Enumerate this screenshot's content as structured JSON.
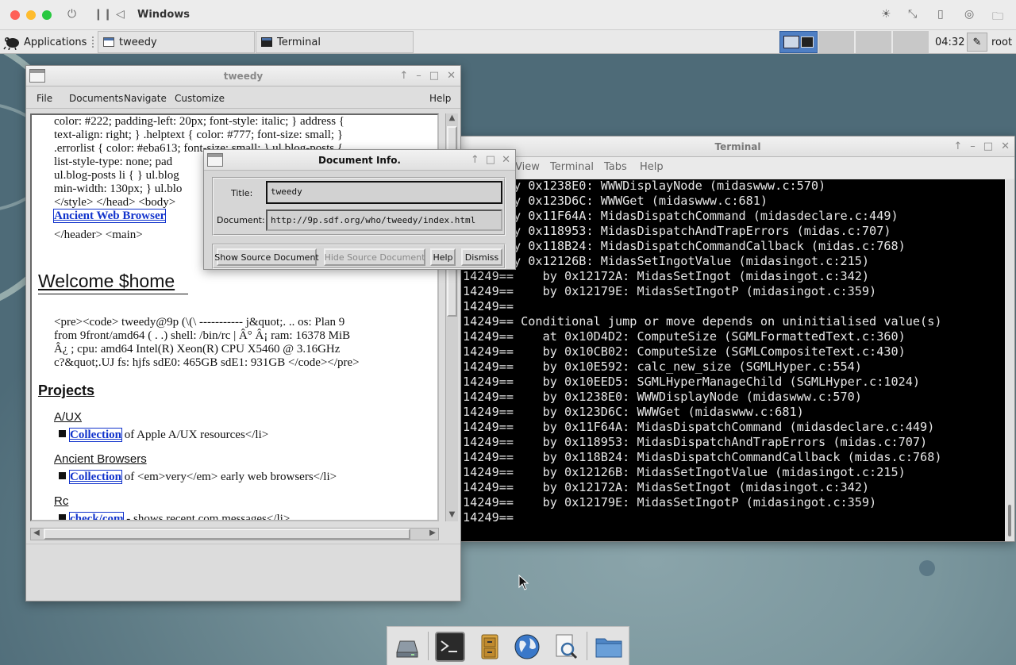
{
  "host": {
    "title": "Windows",
    "colors": {
      "close": "#fe5f57",
      "minimize": "#febc2e",
      "zoom": "#28c840"
    },
    "icons": [
      "power-icon",
      "pause-icon",
      "back-icon",
      "brightness-icon",
      "resize-icon",
      "usb-icon",
      "display-icon",
      "folder-icon"
    ]
  },
  "panel": {
    "applications": "Applications",
    "tasks": [
      {
        "label": "tweedy"
      },
      {
        "label": "Terminal"
      }
    ],
    "clock": "04:32",
    "user": "root"
  },
  "tweedy": {
    "title": "tweedy",
    "menu": [
      "File",
      "Documents",
      "Navigate",
      "Customize",
      "Help"
    ],
    "css_lines": [
      "color: #222; padding-left: 20px; font-style: italic; } address {",
      "text-align: right; } .helptext { color: #777; font-size: small; }",
      ".errorlist { color: #eba613; font-size: small; } ul.blog-posts {",
      "list-style-type: none; pad",
      "ul.blog-posts li { } ul.blog",
      "min-width: 130px; } ul.blo",
      "</style> </head> <body>"
    ],
    "link_ancient": "Ancient Web Browser",
    "header_close": "</header> <main>",
    "heading": "Welcome $home",
    "pre_lines": [
      "<pre><code> tweedy@9p (\\(\\ ----------- j&quot;. .. os: Plan 9",
      "from 9front/amd64 ( . .) shell: /bin/rc | Â° Â¡ ram: 16378 MiB",
      "Â¿ ; cpu: amd64 Intel(R) Xeon(R) CPU X5460 @ 3.16GHz",
      "c?&quot;.UJ fs: hjfs sdE0: 465GB sdE1: 931GB </code></pre>"
    ],
    "projects_heading": "Projects",
    "projects": [
      {
        "name": "A/UX",
        "link": "Collection",
        "desc": " of Apple A/UX resources</li>"
      },
      {
        "name": "Ancient Browsers",
        "link": "Collection",
        "desc": " of <em>very</em> early web browsers</li>"
      },
      {
        "name": "Rc",
        "link": "check/com",
        "desc": " - shows recent com messages</li>"
      }
    ]
  },
  "docinfo": {
    "title": "Document Info.",
    "title_label": "Title:",
    "title_value": "tweedy",
    "document_label": "Document:",
    "document_value": "http://9p.sdf.org/who/tweedy/index.html",
    "buttons": {
      "show_source": "Show Source Document",
      "hide_source": "Hide Source Document",
      "help": "Help",
      "dismiss": "Dismiss"
    }
  },
  "terminal": {
    "title": "Terminal",
    "menu": [
      "View",
      "Terminal",
      "Tabs",
      "Help"
    ],
    "lines": [
      "==    by 0x1238E0: WWWDisplayNode (midaswww.c:570)",
      "==    by 0x123D6C: WWWGet (midaswww.c:681)",
      "==    by 0x11F64A: MidasDispatchCommand (midasdeclare.c:449)",
      "==    by 0x118953: MidasDispatchAndTrapErrors (midas.c:707)",
      "==    by 0x118B24: MidasDispatchCommandCallback (midas.c:768)",
      "==    by 0x12126B: MidasSetIngotValue (midasingot.c:215)",
      "14249==    by 0x12172A: MidasSetIngot (midasingot.c:342)",
      "14249==    by 0x12179E: MidasSetIngotP (midasingot.c:359)",
      "14249==",
      "14249== Conditional jump or move depends on uninitialised value(s)",
      "14249==    at 0x10D4D2: ComputeSize (SGMLFormattedText.c:360)",
      "14249==    by 0x10CB02: ComputeSize (SGMLCompositeText.c:430)",
      "14249==    by 0x10E592: calc_new_size (SGMLHyper.c:554)",
      "14249==    by 0x10EED5: SGMLHyperManageChild (SGMLHyper.c:1024)",
      "14249==    by 0x1238E0: WWWDisplayNode (midaswww.c:570)",
      "14249==    by 0x123D6C: WWWGet (midaswww.c:681)",
      "14249==    by 0x11F64A: MidasDispatchCommand (midasdeclare.c:449)",
      "14249==    by 0x118953: MidasDispatchAndTrapErrors (midas.c:707)",
      "14249==    by 0x118B24: MidasDispatchCommandCallback (midas.c:768)",
      "14249==    by 0x12126B: MidasSetIngotValue (midasingot.c:215)",
      "14249==    by 0x12172A: MidasSetIngot (midasingot.c:342)",
      "14249==    by 0x12179E: MidasSetIngotP (midasingot.c:359)",
      "14249=="
    ]
  },
  "dock": {
    "items": [
      "drive-icon",
      "terminal-icon",
      "file-cabinet-icon",
      "globe-icon",
      "search-document-icon",
      "folder-icon"
    ]
  }
}
